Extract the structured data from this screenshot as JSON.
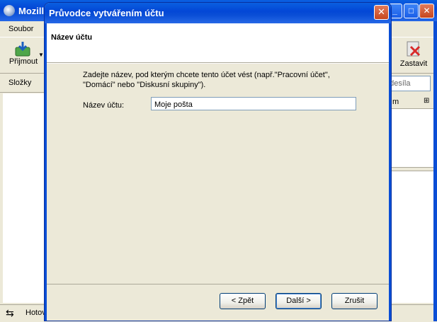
{
  "background_window": {
    "title": "Mozill",
    "menu": {
      "first_item": "Soubor"
    },
    "toolbar": {
      "receive_label": "Přijmout",
      "stop_label": "Zastavit"
    },
    "folders_label": "Složky",
    "search_placeholder": "odesíla",
    "column_header": "m",
    "status_text": "Hotov"
  },
  "dialog": {
    "title": "Průvodce vytvářením účtu",
    "close_glyph": "✕",
    "header": "Název účtu",
    "description": "Zadejte název, pod kterým chcete tento účet vést (např.\"Pracovní účet\", \"Domácí\" nebo \"Diskusní skupiny\").",
    "field_label": "Název účtu:",
    "field_value": "Moje pošta",
    "buttons": {
      "back": "< Zpět",
      "next": "Další >",
      "cancel": "Zrušit"
    }
  },
  "colors": {
    "title_blue": "#0a4ed6",
    "face": "#ece9d8",
    "close_red": "#c6461e"
  }
}
